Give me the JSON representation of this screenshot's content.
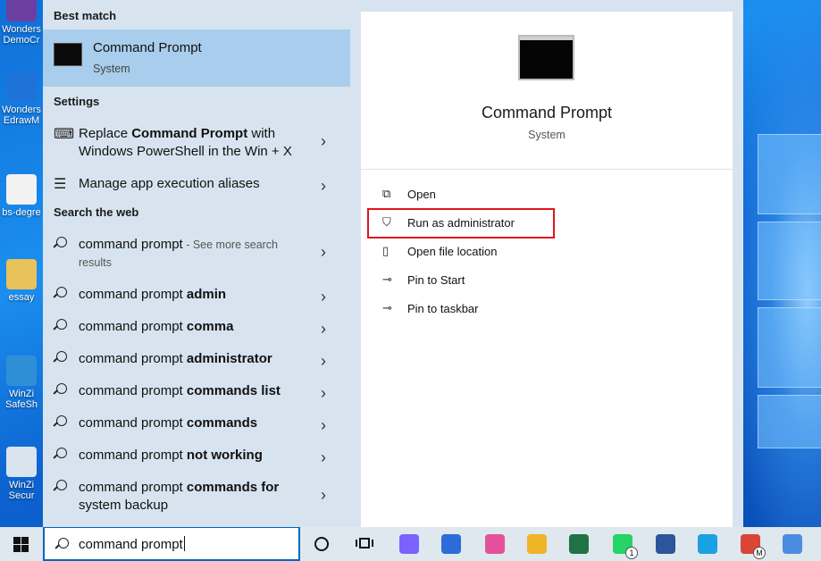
{
  "desktop": {
    "icons": [
      {
        "label": "Wonders",
        "label2": "DemoCr",
        "color": "#6b3fa0"
      },
      {
        "label": "Wonders",
        "label2": "EdrawM",
        "color": "#1e73d8"
      },
      {
        "label": "bs-degre",
        "label2": "",
        "color": "#f2f2f2"
      },
      {
        "label": "essay",
        "label2": "",
        "color": "#e8c25a"
      },
      {
        "label": "WinZi",
        "label2": "SafeSh",
        "color": "#2f8fd6"
      },
      {
        "label": "WinZi",
        "label2": "Secur",
        "color": "#d9e4ee"
      }
    ]
  },
  "start_menu": {
    "best_match": {
      "section_title": "Best match",
      "name": "Command Prompt",
      "subtitle": "System"
    },
    "settings": {
      "section_title": "Settings",
      "items": [
        {
          "pre": "Replace ",
          "bold": "Command Prompt",
          "post": " with",
          "line2": "Windows PowerShell in the Win + X",
          "icon": "keyboard-icon"
        },
        {
          "pre": "Manage app execution aliases",
          "bold": "",
          "post": "",
          "line2": "",
          "icon": "list-icon"
        }
      ]
    },
    "web": {
      "section_title": "Search the web",
      "items": [
        {
          "pre": "command prompt",
          "bold": "",
          "muted": " - See more search",
          "line2": "results"
        },
        {
          "pre": "command prompt ",
          "bold": "admin",
          "muted": "",
          "line2": ""
        },
        {
          "pre": "command prompt ",
          "bold": "comma",
          "muted": "",
          "line2": ""
        },
        {
          "pre": "command prompt ",
          "bold": "administrator",
          "muted": "",
          "line2": ""
        },
        {
          "pre": "command prompt ",
          "bold": "commands list",
          "muted": "",
          "line2": ""
        },
        {
          "pre": "command prompt ",
          "bold": "commands",
          "muted": "",
          "line2": ""
        },
        {
          "pre": "command prompt ",
          "bold": "not working",
          "muted": "",
          "line2": ""
        },
        {
          "pre": "command prompt ",
          "bold": "commands for",
          "muted": "",
          "line2": "system backup"
        }
      ]
    },
    "preview": {
      "title": "Command Prompt",
      "subtitle": "System",
      "actions": [
        {
          "label": "Open",
          "icon": "open-icon"
        },
        {
          "label": "Run as administrator",
          "icon": "shield-icon"
        },
        {
          "label": "Open file location",
          "icon": "file-location-icon"
        },
        {
          "label": "Pin to Start",
          "icon": "pin-icon"
        },
        {
          "label": "Pin to taskbar",
          "icon": "pin-icon"
        }
      ],
      "highlighted_action": "Run as administrator",
      "highlight_color": "#e0141b"
    }
  },
  "taskbar": {
    "search_value": "command prompt",
    "apps": [
      {
        "name": "copilot-icon",
        "color": "#7b61ff"
      },
      {
        "name": "microsoft-store-icon",
        "color": "#2b6cd8"
      },
      {
        "name": "paint-icon",
        "color": "#e5509a"
      },
      {
        "name": "file-explorer-icon",
        "color": "#f0b429"
      },
      {
        "name": "excel-icon",
        "color": "#1f7244"
      },
      {
        "name": "whatsapp-icon",
        "color": "#25d366",
        "badge": "1"
      },
      {
        "name": "word-icon",
        "color": "#2b579a"
      },
      {
        "name": "edge-icon",
        "color": "#1ba1e2"
      },
      {
        "name": "chrome-icon",
        "color": "#db4437",
        "badge": "M"
      },
      {
        "name": "app-icon",
        "color": "#4a8de0"
      }
    ]
  },
  "colors": {
    "accent": "#0067c0",
    "selected_bg": "#a9cdec",
    "menu_bg": "#d7e4ef"
  }
}
